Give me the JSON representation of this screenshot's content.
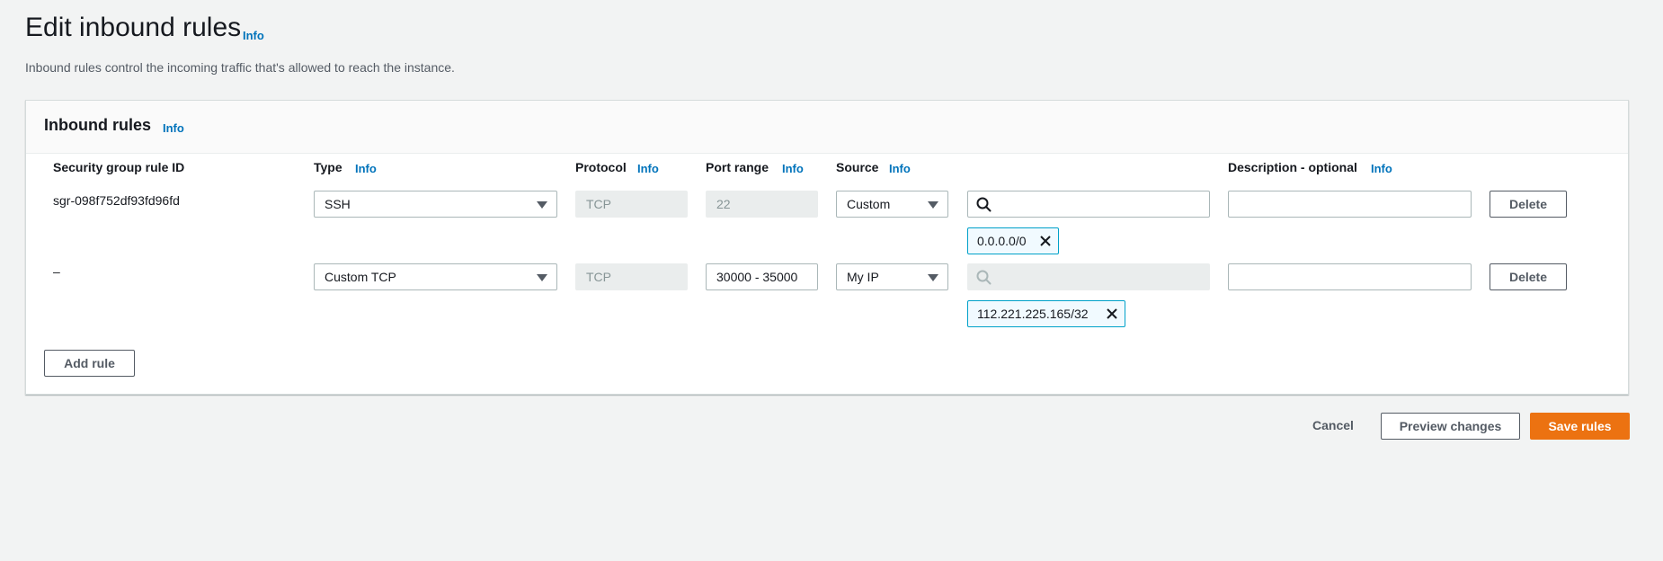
{
  "page": {
    "title": "Edit inbound rules",
    "info": "Info",
    "description": "Inbound rules control the incoming traffic that's allowed to reach the instance."
  },
  "panel": {
    "title": "Inbound rules",
    "info": "Info",
    "columns": {
      "rule_id": "Security group rule ID",
      "type": "Type",
      "protocol": "Protocol",
      "port_range": "Port range",
      "source": "Source",
      "description": "Description - optional"
    },
    "column_info": "Info",
    "rules": [
      {
        "rule_id": "sgr-098f752df93fd96fd",
        "type": "SSH",
        "protocol": "TCP",
        "port_range": "22",
        "source": "Custom",
        "search_value": "",
        "token": "0.0.0.0/0",
        "description": "",
        "delete_label": "Delete"
      },
      {
        "rule_id": "–",
        "type": "Custom TCP",
        "protocol": "TCP",
        "port_range": "30000 - 35000",
        "source": "My IP",
        "search_value": "",
        "token": "112.221.225.165/32",
        "description": "",
        "delete_label": "Delete"
      }
    ],
    "add_rule_label": "Add rule"
  },
  "footer": {
    "cancel_label": "Cancel",
    "preview_label": "Preview changes",
    "save_label": "Save rules"
  },
  "colors": {
    "accent_link": "#0073bb",
    "primary_button": "#ec7211",
    "token_border": "#00a1c9"
  }
}
